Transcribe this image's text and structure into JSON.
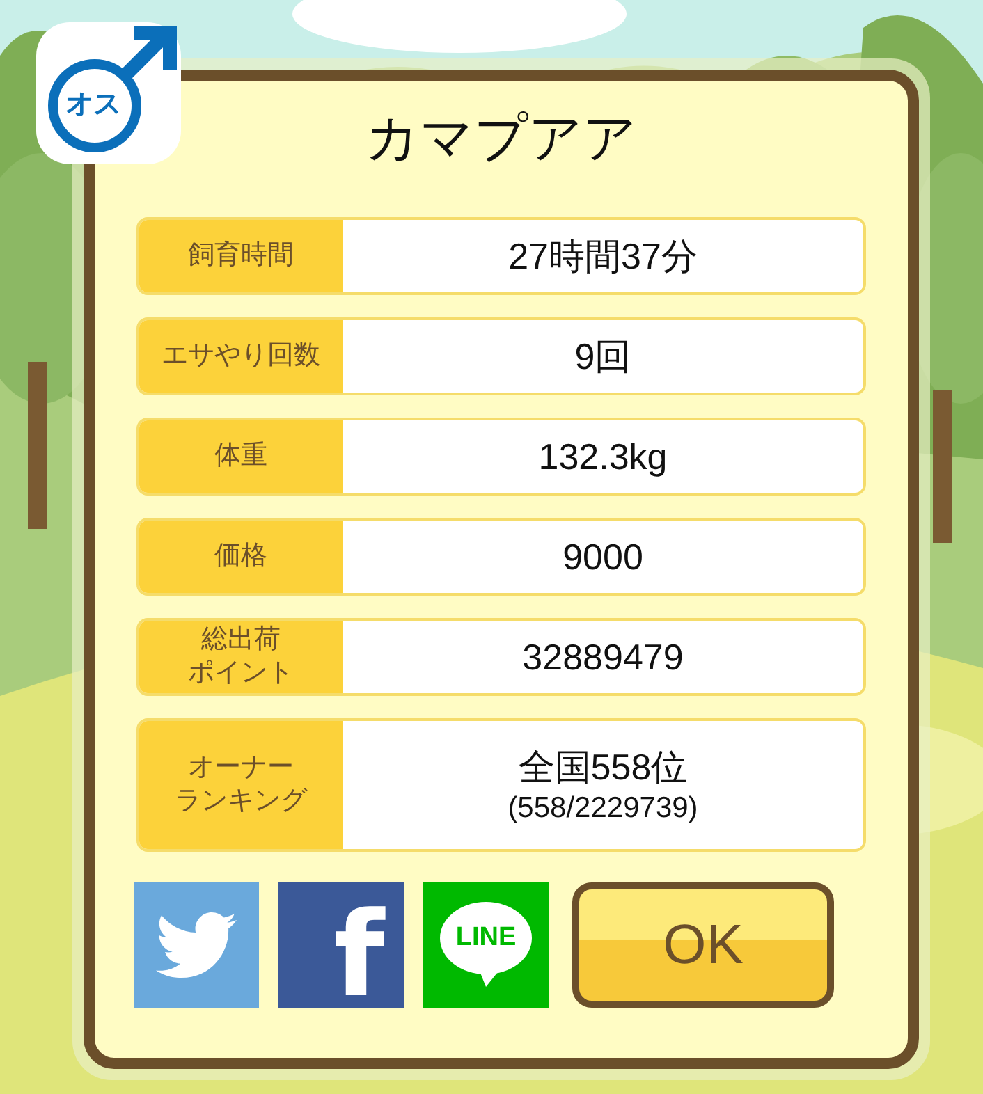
{
  "badge": {
    "text": "オス"
  },
  "title": "カマプアア",
  "stats": [
    {
      "label": [
        "飼育時間"
      ],
      "value": "27時間37分"
    },
    {
      "label": [
        "エサやり回数"
      ],
      "value": "9回"
    },
    {
      "label": [
        "体重"
      ],
      "value": "132.3kg"
    },
    {
      "label": [
        "価格"
      ],
      "value": "9000"
    },
    {
      "label": [
        "総出荷",
        "ポイント"
      ],
      "value": "32889479"
    },
    {
      "label": [
        "オーナー",
        "ランキング"
      ],
      "value": "全国558位",
      "detail": "(558/2229739)"
    }
  ],
  "share": [
    {
      "kind": "twitter"
    },
    {
      "kind": "facebook",
      "text": "f"
    },
    {
      "kind": "line",
      "text": "LINE"
    }
  ],
  "ok_button": "OK"
}
